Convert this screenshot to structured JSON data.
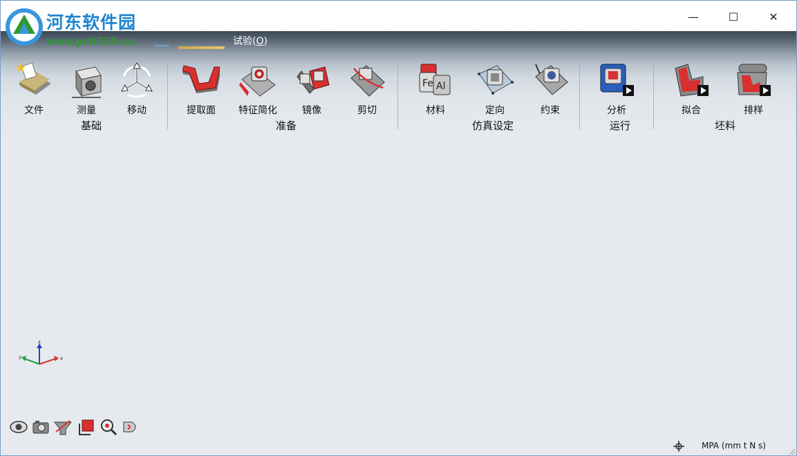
{
  "watermark": {
    "title": "河东软件园",
    "url": "www.pc0359.cn"
  },
  "window_controls": {
    "minimize": "—",
    "maximize": "☐",
    "close": "✕"
  },
  "menu": {
    "experiment_label": "试验(",
    "experiment_key": "O",
    "experiment_end": ")"
  },
  "groups": [
    {
      "label": "基础",
      "tools": [
        {
          "label": "文件",
          "icon": "file-icon"
        },
        {
          "label": "测量",
          "icon": "measure-icon"
        },
        {
          "label": "移动",
          "icon": "move-icon"
        }
      ]
    },
    {
      "label": "准备",
      "tools": [
        {
          "label": "提取面",
          "icon": "extract-face-icon"
        },
        {
          "label": "特征简化",
          "icon": "feature-simplify-icon"
        },
        {
          "label": "镜像",
          "icon": "mirror-icon"
        },
        {
          "label": "剪切",
          "icon": "cut-icon"
        }
      ]
    },
    {
      "label": "仿真设定",
      "tools": [
        {
          "label": "材料",
          "icon": "material-icon"
        },
        {
          "label": "定向",
          "icon": "orientation-icon"
        },
        {
          "label": "约束",
          "icon": "constraint-icon"
        }
      ]
    },
    {
      "label": "运行",
      "tools": [
        {
          "label": "分析",
          "icon": "analysis-icon"
        }
      ]
    },
    {
      "label": "坯料",
      "tools": [
        {
          "label": "拟合",
          "icon": "fit-icon"
        },
        {
          "label": "排样",
          "icon": "nesting-icon"
        }
      ]
    }
  ],
  "axis": {
    "z": "z",
    "x": "x",
    "y": "y"
  },
  "status": {
    "units": "MPA (mm t N s)"
  },
  "colors": {
    "accent_red": "#d83030",
    "ribbon_dark": "#3b4854",
    "watermark_blue": "#1e84d0",
    "watermark_green": "#2f9a2f"
  }
}
